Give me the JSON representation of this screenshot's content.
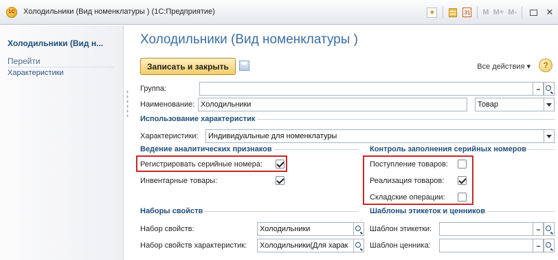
{
  "window": {
    "app_logo": "1С",
    "title": "Холодильники (Вид номенклатуры ) (1С:Предприятие)",
    "toolbar_labels": [
      "M",
      "M+",
      "M-"
    ]
  },
  "sidebar": {
    "title": "Холодильники (Вид н...",
    "goto": "Перейти",
    "items": [
      {
        "label": "Характеристики"
      }
    ]
  },
  "form": {
    "title": "Холодильники (Вид номенклатуры )",
    "save_close_label": "Записать и закрыть",
    "all_actions_label": "Все действия ▾",
    "help_label": "?",
    "group": {
      "label": "Группа:",
      "value": ""
    },
    "name": {
      "label": "Наименование:",
      "value": "Холодильники",
      "type_value": "Товар"
    },
    "section_characteristics": "Использование характеристик",
    "characteristics": {
      "label": "Характеристики:",
      "value": "Индивидуальные для номенклатуры"
    },
    "section_analytics": "Ведение аналитических признаков",
    "serial_numbers": {
      "label": "Регистрировать серийные номера:",
      "checked": true
    },
    "inventory_goods": {
      "label": "Инвентарные товары:",
      "checked": true
    },
    "section_control": "Контроль заполнения серийных номеров",
    "goods_receipt": {
      "label": "Поступление товаров:",
      "checked": false
    },
    "goods_sale": {
      "label": "Реализация товаров:",
      "checked": true
    },
    "warehouse_ops": {
      "label": "Складские операции:",
      "checked": false
    },
    "section_property_sets": "Наборы свойств",
    "property_set": {
      "label": "Набор свойств:",
      "value": "Холодильники"
    },
    "char_property_set": {
      "label": "Набор свойств характеристик:",
      "value": "Холодильники(Для харак"
    },
    "section_templates": "Шаблоны этикеток и ценников",
    "label_template": {
      "label": "Шаблон этикетки:",
      "value": ""
    },
    "price_template": {
      "label": "Шаблон ценника:",
      "value": ""
    }
  },
  "colors": {
    "accent": "#3a6ea5",
    "highlight": "#c62828",
    "button": "#f2cd66"
  }
}
